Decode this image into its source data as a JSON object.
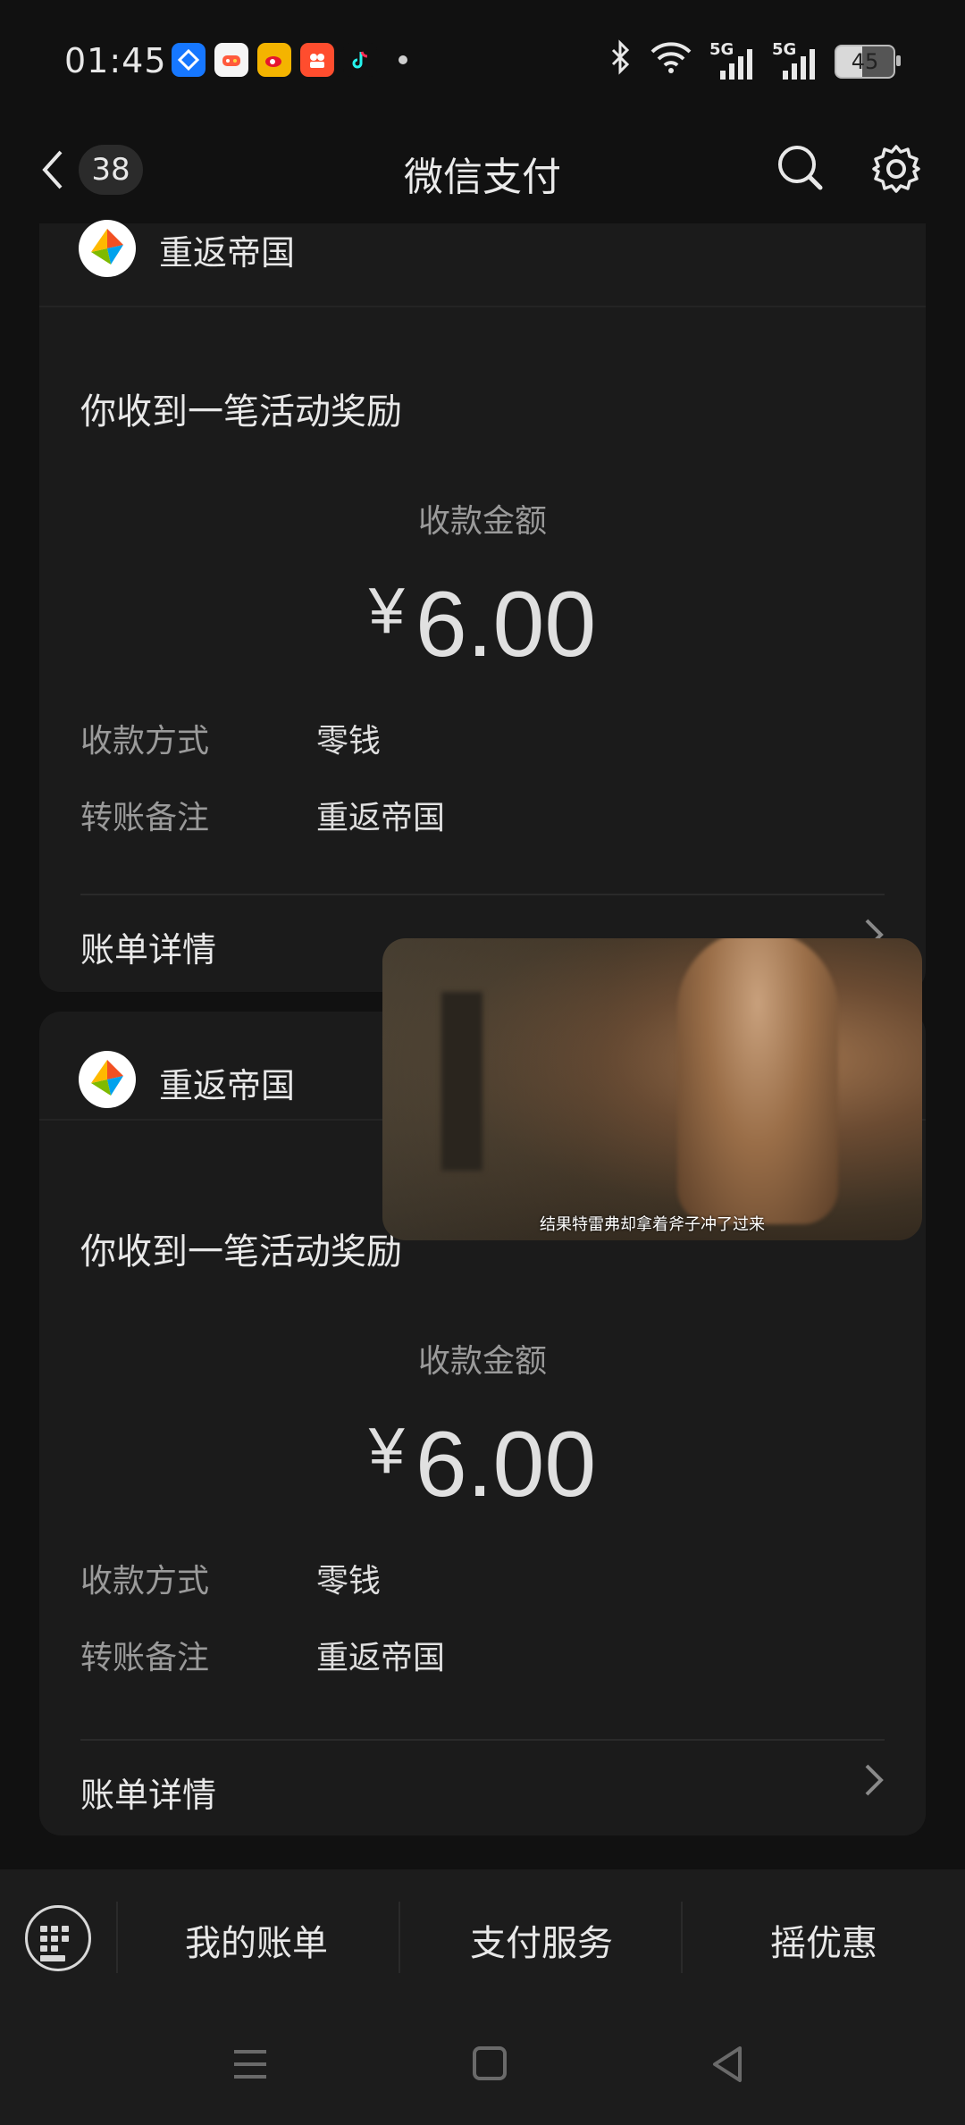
{
  "status_bar": {
    "time": "01:45",
    "battery": "45",
    "app_icons": [
      "alipay-icon",
      "game-icon",
      "weibo-icon",
      "video-app-icon",
      "tiktok-icon"
    ],
    "network": [
      "5G",
      "5G"
    ]
  },
  "header": {
    "back_count": "38",
    "title": "微信支付"
  },
  "cards": [
    {
      "sender": "重返帝国",
      "headline": "你收到一笔活动奖励",
      "amount_label": "收款金额",
      "currency": "¥",
      "amount": "6.00",
      "rows": [
        {
          "label": "收款方式",
          "value": "零钱"
        },
        {
          "label": "转账备注",
          "value": "重返帝国"
        }
      ],
      "detail": "账单详情"
    },
    {
      "sender": "重返帝国",
      "headline": "你收到一笔活动奖励",
      "amount_label": "收款金额",
      "currency": "¥",
      "amount": "6.00",
      "rows": [
        {
          "label": "收款方式",
          "value": "零钱"
        },
        {
          "label": "转账备注",
          "value": "重返帝国"
        }
      ],
      "detail": "账单详情"
    }
  ],
  "pip": {
    "subtitle": "结果特雷弗却拿着斧子冲了过来"
  },
  "bottom_menu": {
    "items": [
      "我的账单",
      "支付服务",
      "摇优惠"
    ]
  },
  "colors": {
    "background": "#111111",
    "card": "#1b1b1b",
    "text": "#e6e6e6",
    "muted": "#9a9a9a"
  }
}
